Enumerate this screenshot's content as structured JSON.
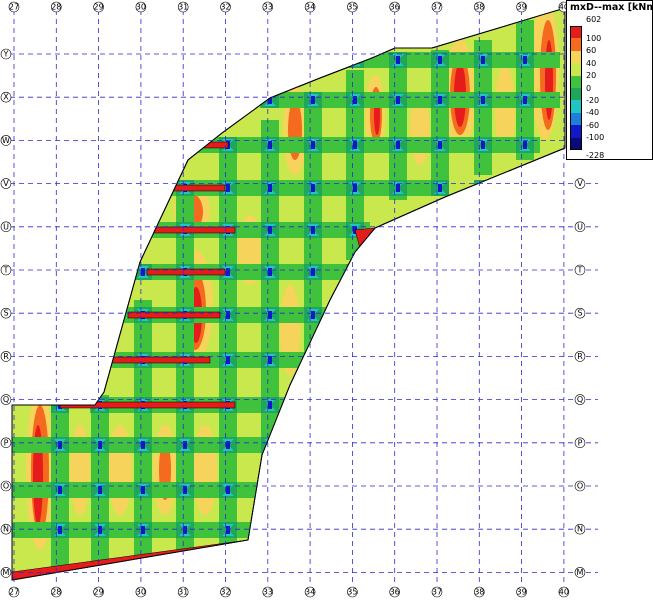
{
  "legend": {
    "title": "mxD--max [kNm/m]",
    "max_label": "602",
    "min_label": "-228",
    "bands": [
      {
        "label": "100",
        "color": "#e61b1b"
      },
      {
        "label": "60",
        "color": "#f46a1f"
      },
      {
        "label": "40",
        "color": "#f6d35a"
      },
      {
        "label": "20",
        "color": "#c8e84e"
      },
      {
        "label": "0",
        "color": "#41c23c"
      },
      {
        "label": "-20",
        "color": "#1fa65b"
      },
      {
        "label": "-40",
        "color": "#21c6c0"
      },
      {
        "label": "-60",
        "color": "#1e7fd9"
      },
      {
        "label": "-100",
        "color": "#1018c8"
      },
      {
        "label": "",
        "color": "#0a0a7a"
      }
    ]
  },
  "grid": {
    "columns": [
      "27",
      "28",
      "29",
      "30",
      "31",
      "32",
      "33",
      "34",
      "35",
      "36",
      "37",
      "38",
      "39",
      "40"
    ],
    "rows_left": [
      "Y",
      "X",
      "W",
      "V",
      "U",
      "T",
      "S",
      "R",
      "Q",
      "P",
      "O",
      "N",
      "M",
      "L"
    ]
  },
  "colors": {
    "grid_line": "#2a2ad0",
    "outline": "#000000",
    "red": "#e61b1b",
    "orange": "#f46a1f",
    "yellow": "#f6d35a",
    "light_green": "#c8e84e",
    "green": "#41c23c",
    "dark_green": "#1fa65b",
    "cyan": "#21c6c0",
    "blue": "#1018c8"
  }
}
